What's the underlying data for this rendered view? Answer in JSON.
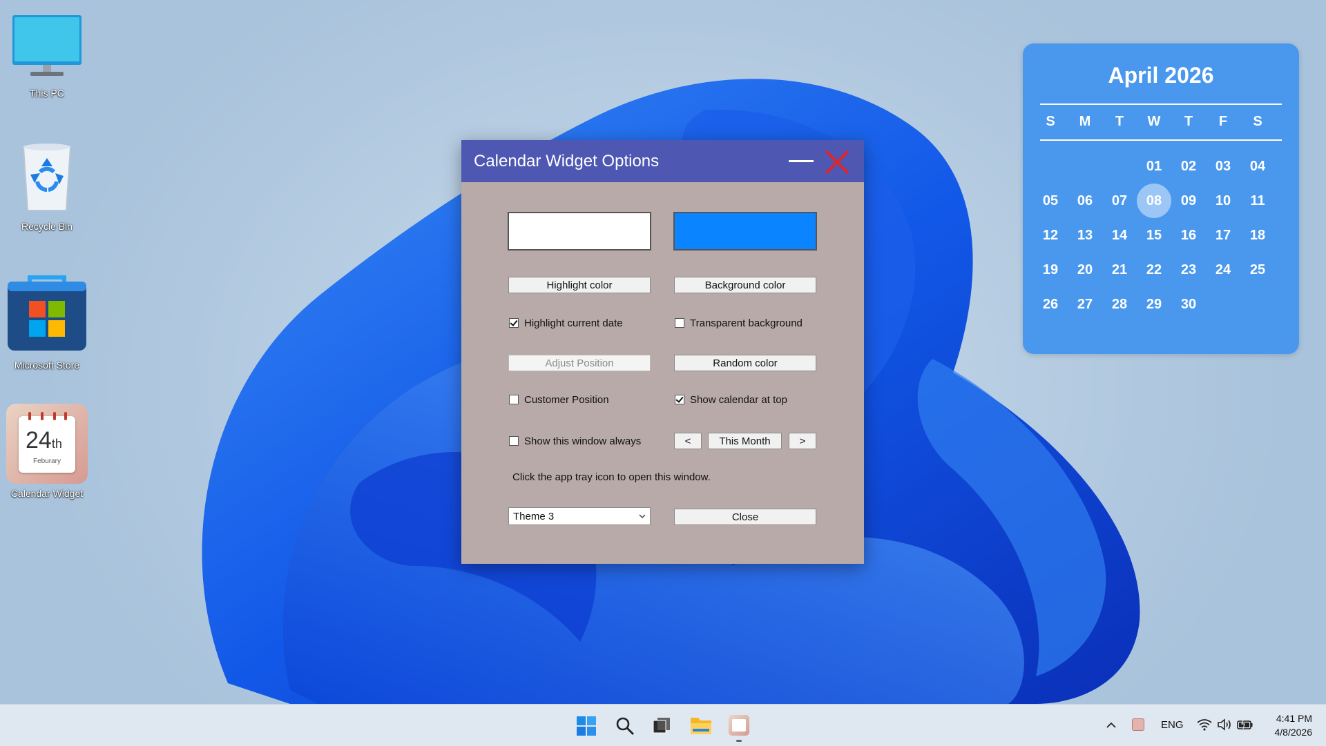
{
  "desktop": {
    "icons": [
      {
        "label": "This PC",
        "icon": "monitor-icon"
      },
      {
        "label": "Recycle Bin",
        "icon": "recycle-bin-icon"
      },
      {
        "label": "Microsoft Store",
        "icon": "store-icon"
      },
      {
        "label": "Calendar Widget",
        "icon": "calendar-app-icon",
        "badge_day": "24",
        "badge_suffix": "th",
        "badge_month": "Feburary"
      }
    ]
  },
  "calendar_widget": {
    "title": "April 2026",
    "weekdays": [
      "S",
      "M",
      "T",
      "W",
      "T",
      "F",
      "S"
    ],
    "first_weekday_index": 3,
    "days": [
      "01",
      "02",
      "03",
      "04",
      "05",
      "06",
      "07",
      "08",
      "09",
      "10",
      "11",
      "12",
      "13",
      "14",
      "15",
      "16",
      "17",
      "18",
      "19",
      "20",
      "21",
      "22",
      "23",
      "24",
      "25",
      "26",
      "27",
      "28",
      "29",
      "30"
    ],
    "today": "08",
    "background_color": "#4a98ee"
  },
  "dialog": {
    "title": "Calendar Widget Options",
    "highlight_swatch_color": "#ffffff",
    "background_swatch_color": "#0a84ff",
    "highlight_color_label": "Highlight color",
    "background_color_label": "Background color",
    "highlight_current_date": {
      "label": "Highlight current date",
      "checked": true
    },
    "transparent_background": {
      "label": "Transparent background",
      "checked": false
    },
    "adjust_position_label": "Adjust Position",
    "random_color_label": "Random color",
    "customer_position": {
      "label": "Customer Position",
      "checked": false
    },
    "show_calendar_top": {
      "label": "Show calendar at top",
      "checked": true
    },
    "show_window_always": {
      "label": "Show this window always",
      "checked": false
    },
    "prev_label": "<",
    "this_month_label": "This Month",
    "next_label": ">",
    "hint": "Click the app tray icon to open this window.",
    "theme_value": "Theme 3",
    "close_label": "Close",
    "titlebar_color": "#4e58b3",
    "body_color": "#b8aaa8"
  },
  "taskbar": {
    "icons": [
      "windows-start-icon",
      "search-icon",
      "task-view-icon",
      "file-explorer-icon",
      "calendar-widget-taskbar-icon"
    ],
    "tray": {
      "language": "ENG",
      "time": "4:41 PM",
      "date": "4/8/2026"
    }
  }
}
